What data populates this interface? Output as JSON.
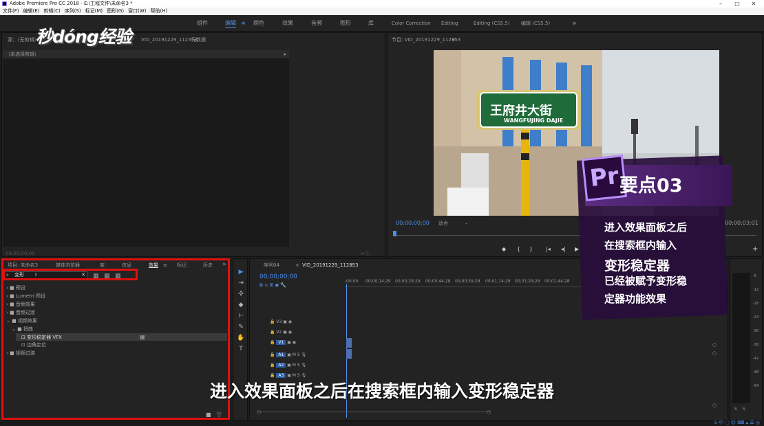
{
  "title_bar": {
    "app_title": "Adobe Premiere Pro CC 2018 - E:\\工程文件\\未命名3 *",
    "minimize": "–",
    "maximize": "□",
    "close": "✕"
  },
  "menu": [
    "文件(F)",
    "编辑(E)",
    "剪辑(C)",
    "序列(S)",
    "标记(M)",
    "图形(G)",
    "窗口(W)",
    "帮助(H)"
  ],
  "workspaces": {
    "w1": "组件",
    "w2": "编辑",
    "w3": "颜色",
    "w4": "效果",
    "w5": "音频",
    "w6": "图形",
    "w7": "库",
    "w8": "Color Correction",
    "w9": "Editing",
    "w10": "Editing (CS5.5)",
    "w11": "编辑 (CS5.5)",
    "more": "»"
  },
  "logo": "秒dóng经验",
  "source": {
    "tab": "源：（无剪辑）",
    "tab2": "VID_20191229_112353",
    "meta": "元数据",
    "no_clip": "（未选择剪辑）",
    "timecode": "00;00;00;00"
  },
  "program": {
    "tab": "节目: VID_20191229_112353",
    "timecode": "00;00;00;00",
    "fit": "适合",
    "duration": "00;00;03;01"
  },
  "sign": {
    "cn": "王府井大街",
    "en": "WANGFUJING DAJIE"
  },
  "project_tabs": {
    "t1": "项目: 未命名3",
    "t2": "媒体浏览器",
    "t3": "库",
    "t4": "信息",
    "t5": "效果",
    "t6": "标记",
    "t7": "历史"
  },
  "search": {
    "value": "变形"
  },
  "tree": {
    "i1": "预设",
    "i2": "Lumetri 预设",
    "i3": "音频效果",
    "i4": "音频过渡",
    "i5": "视频效果",
    "i6": "扭曲",
    "i7": "变形稳定器 VFX",
    "i8": "边角定位",
    "i9": "视频过渡"
  },
  "timeline": {
    "tab1": "序列04",
    "tab2": "VID_20191229_112353",
    "timecode": "00;00;00;00",
    "ruler": [
      ";00;00",
      "00;00;14;29",
      "00;00;29;29",
      "00;00;44;28",
      "00;00;59;28",
      "00;01;14;29",
      "00;01;29;29",
      "00;01;44;28"
    ],
    "tracks": [
      "V3",
      "V2",
      "V1",
      "A1",
      "A2",
      "A3"
    ]
  },
  "meter_scale": [
    "-6",
    "-12",
    "-18",
    "-24",
    "-30",
    "-36",
    "-42",
    "-48",
    "-54"
  ],
  "meter_s": "S",
  "card": {
    "logo": "Pr",
    "title": "要点03",
    "lines": [
      "进入效果面板之后",
      "在搜索框内输入",
      "变形稳定器",
      "已经被赋予变形稳",
      "定器功能效果"
    ]
  },
  "subtitle": "进入效果面板之后在搜索框内输入变形稳定器",
  "colors": {
    "accent": "#4d8fe8",
    "highlight": "#e01010",
    "card": "#2a0a3d"
  }
}
